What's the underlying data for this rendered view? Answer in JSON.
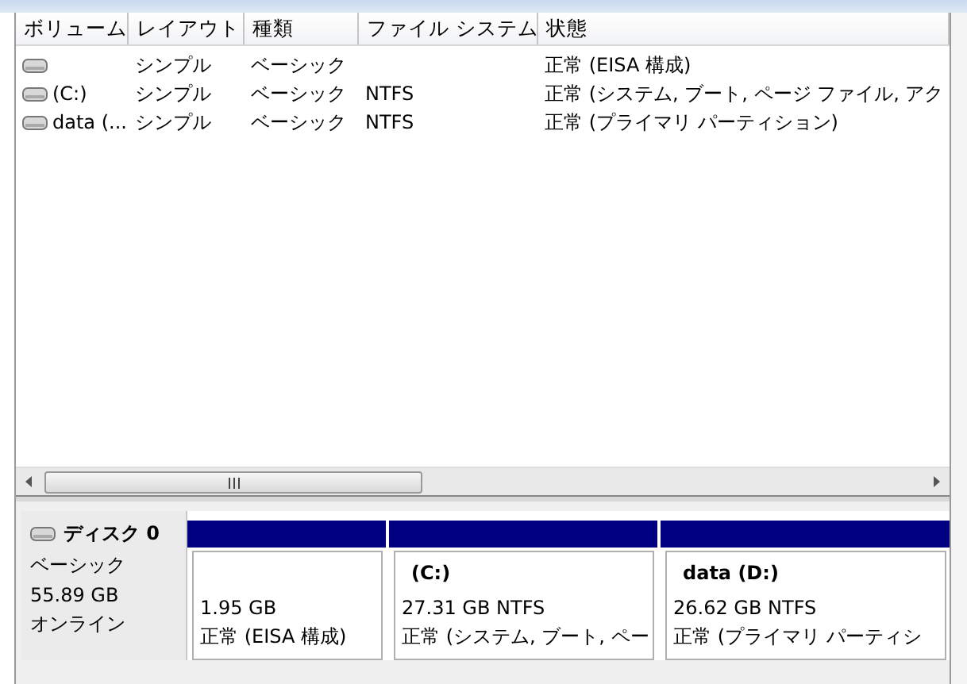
{
  "columns": [
    "ボリューム",
    "レイアウト",
    "種類",
    "ファイル システム",
    "状態"
  ],
  "volumes": [
    {
      "layout": "シンプル",
      "type": "ベーシック",
      "status": "正常 (EISA 構成)"
    },
    {
      "name": "(C:)",
      "layout": "シンプル",
      "type": "ベーシック",
      "filesystem": "NTFS",
      "status": "正常 (システム, ブート, ページ ファイル, アク"
    },
    {
      "name": "data (...",
      "layout": "シンプル",
      "type": "ベーシック",
      "filesystem": "NTFS",
      "status": "正常 (プライマリ パーティション)"
    }
  ],
  "disk": {
    "name": "ディスク 0",
    "type": "ベーシック",
    "size": "55.89 GB",
    "status": "オンライン"
  },
  "partitions": [
    {
      "size": "1.95 GB",
      "status": "正常 (EISA 構成)"
    },
    {
      "label": "(C:)",
      "size": "27.31 GB NTFS",
      "status": "正常 (システム, ブート, ペー"
    },
    {
      "label": "data  (D:)",
      "size": "26.62 GB NTFS",
      "status": "正常 (プライマリ パーティシ"
    }
  ]
}
